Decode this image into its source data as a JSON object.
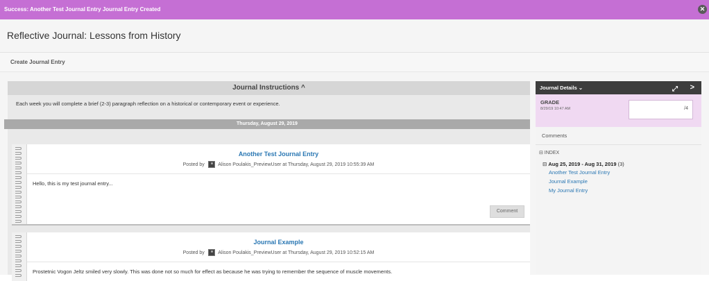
{
  "banner": {
    "message": "Success: Another Test Journal Entry Journal Entry Created",
    "close_glyph": "✕"
  },
  "page": {
    "title": "Reflective Journal: Lessons from History",
    "create_label": "Create Journal Entry"
  },
  "instructions": {
    "heading": "Journal Instructions ^",
    "text": "Each week you will complete a brief (2-3) paragraph reflection on a historical or contemporary event or experience."
  },
  "date_header": "Thursday, August 29, 2019",
  "entries": [
    {
      "title": "Another Test Journal Entry",
      "posted_prefix": "Posted by",
      "author": "Alison Poulakis_PreviewUser",
      "posted_at": "at Thursday, August 29, 2019 10:55:39 AM",
      "body": "Hello, this is my test journal entry...",
      "comment_label": "Comment"
    },
    {
      "title": "Journal Example",
      "posted_prefix": "Posted by",
      "author": "Alison Poulakis_PreviewUser",
      "posted_at": "at Thursday, August 29, 2019 10:52:15 AM",
      "body": "Prostetnic Vogon Jeltz smiled very slowly. This was done not so  much for effect as because he was trying to remember the sequence  of muscle movements."
    }
  ],
  "side": {
    "header": "Journal Details ⌄",
    "expand_icon": "expand-icon",
    "next_glyph": ">",
    "grade_label": "GRADE",
    "grade_date": "8/29/19 10:47 AM",
    "grade_value": "/4",
    "comments_label": "Comments",
    "index_label": "⊟ INDEX",
    "range_prefix": "⊟",
    "range": "Aug 25, 2019 - Aug 31, 2019",
    "range_count": "(3)",
    "links": [
      "Another Test Journal Entry",
      "Journal Example",
      "My Journal Entry"
    ]
  },
  "colors": {
    "banner": "#c56fd4",
    "link": "#2a77b3",
    "side_header": "#3d3d3d",
    "grade_bg": "#f0d9f2"
  }
}
